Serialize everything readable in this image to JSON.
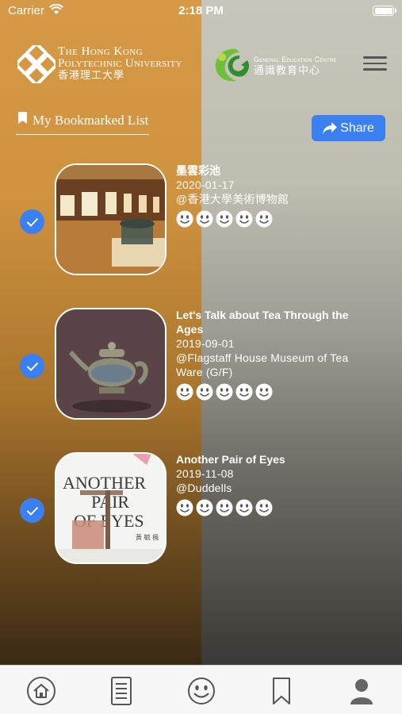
{
  "status_bar": {
    "carrier": "Carrier",
    "time": "2:18 PM"
  },
  "header": {
    "polyu_line1": "The Hong Kong",
    "polyu_line2": "Polytechnic University",
    "polyu_line3": "香港理工大學",
    "gec_line1": "General Education Centre",
    "gec_line2": "通識教育中心",
    "menu_icon": "hamburger-menu-icon"
  },
  "bookmark_section": {
    "title": "My Bookmarked List",
    "share_label": "Share"
  },
  "items": [
    {
      "title": "墨雲彩池",
      "date": "2020-01-17",
      "venue": "@香港大學美術博物館",
      "checked": true,
      "rating_faces": 5
    },
    {
      "title": "Let's Talk about Tea Through the Ages",
      "date": "2019-09-01",
      "venue": "@Flagstaff House Museum of Tea Ware (G/F)",
      "checked": true,
      "rating_faces": 5
    },
    {
      "title": "Another Pair of Eyes",
      "date": "2019-11-08",
      "venue": "@Duddells",
      "checked": true,
      "rating_faces": 5,
      "thumb_text_1": "ANOTHER",
      "thumb_text_2": "PAIR",
      "thumb_text_3": "OF EYES",
      "thumb_text_4": "黃 毓 楓"
    }
  ],
  "tab_bar": [
    "home-icon",
    "list-icon",
    "smiley-icon",
    "bookmark-icon",
    "profile-icon"
  ],
  "colors": {
    "accent": "#3a80f0",
    "left_bg": "#d69a46",
    "right_bg": "#c6c6ba"
  }
}
